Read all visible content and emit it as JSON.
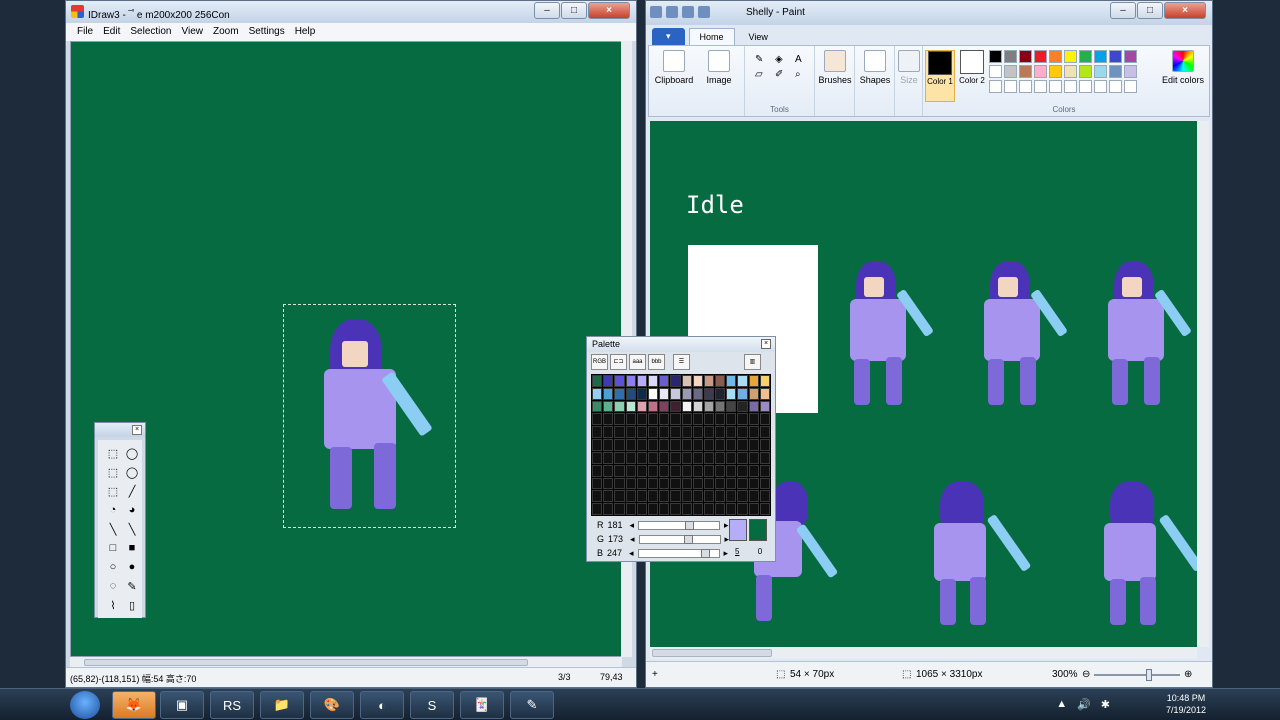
{
  "idraw": {
    "title": "IDraw3 - ‾ﾟe m200x200 256Con",
    "menu": [
      "File",
      "Edit",
      "Selection",
      "View",
      "Zoom",
      "Settings",
      "Help"
    ],
    "status_left": "(65,82)-(118,151) 幅:54 高さ:70",
    "status_page": "3/3",
    "status_pos": "79,43"
  },
  "tools": {
    "close_glyph": "×",
    "items": [
      "⬚",
      "◯",
      "⬚",
      "◯",
      "⬚",
      "╱",
      "◔",
      "◕",
      "╲",
      "╲",
      "□",
      "■",
      "○",
      "●",
      "◌",
      "✎",
      "⌇",
      "▯"
    ]
  },
  "palette": {
    "title": "Palette",
    "close_glyph": "×",
    "buttons": [
      "RGB",
      "⊏⊐",
      "aaa",
      "bbb",
      "☰",
      "▥"
    ],
    "swatch_colors": [
      "#1b6b4a",
      "#3d3bb2",
      "#5c52d8",
      "#8a7ef0",
      "#b5adf7",
      "#dcd8fb",
      "#6a5ed0",
      "#2a2570",
      "#d9c2b4",
      "#f3d6c2",
      "#c89a86",
      "#8a5a4c",
      "#6fb8e8",
      "#a9dcf5",
      "#e6a53a",
      "#f5d36a",
      "#8fd0f4",
      "#4aa0d8",
      "#2e6fb0",
      "#204c80",
      "#0f2b4a",
      "#ffffff",
      "#e8e8f4",
      "#c8c8dc",
      "#9a9ab4",
      "#6a6a84",
      "#3c3c50",
      "#20242e",
      "#a2e0f8",
      "#70b0e0",
      "#d0a070",
      "#f0c090",
      "#3a8a6a",
      "#5ab08c",
      "#88d0b0",
      "#b8e8d4",
      "#e0a0b0",
      "#c07088",
      "#804060",
      "#402030",
      "#f4f4f4",
      "#d4d4d4",
      "#a4a4a4",
      "#747474",
      "#444444",
      "#242424",
      "#7a6aa8",
      "#9a8ac8"
    ],
    "r_label": "R",
    "r_value": "181",
    "g_label": "G",
    "g_value": "173",
    "b_label": "B",
    "b_value": "247",
    "left_arrow": "◂",
    "right_arrow": "▸",
    "num1": "5",
    "num2": "0"
  },
  "paint": {
    "title": "Shelly - Paint",
    "tabs": [
      "Home",
      "View"
    ],
    "groups": {
      "clipboard": "Clipboard",
      "image": "Image",
      "tools": "Tools",
      "brushes": "Brushes",
      "shapes": "Shapes",
      "size": "Size",
      "color1": "Color 1",
      "color2": "Color 2",
      "colors": "Colors",
      "edit_colors": "Edit colors"
    },
    "colors": [
      "#000000",
      "#7f7f7f",
      "#880015",
      "#ed1c24",
      "#ff7f27",
      "#fff200",
      "#22b14c",
      "#00a2e8",
      "#3f48cc",
      "#a349a4",
      "#ffffff",
      "#c3c3c3",
      "#b97a57",
      "#ffaec9",
      "#ffc90e",
      "#efe4b0",
      "#b5e61d",
      "#99d9ea",
      "#7092be",
      "#c8bfe7",
      "#ffffff",
      "#ffffff",
      "#ffffff",
      "#ffffff",
      "#ffffff",
      "#ffffff",
      "#ffffff",
      "#ffffff",
      "#ffffff",
      "#ffffff"
    ],
    "color1": "#000000",
    "color2": "#ffffff",
    "canvas_heading": "Idle",
    "status_selection": "54 × 70px",
    "status_size": "1065 × 3310px",
    "zoom": "300%"
  },
  "taskbar": {
    "apps": [
      "🦊",
      "▣",
      "RS",
      "📁",
      "🎨",
      "◐",
      "S",
      "🃏",
      "✎"
    ],
    "time": "10:48 PM",
    "date": "7/19/2012",
    "tray": [
      "▲",
      "🔊",
      "✱"
    ]
  }
}
